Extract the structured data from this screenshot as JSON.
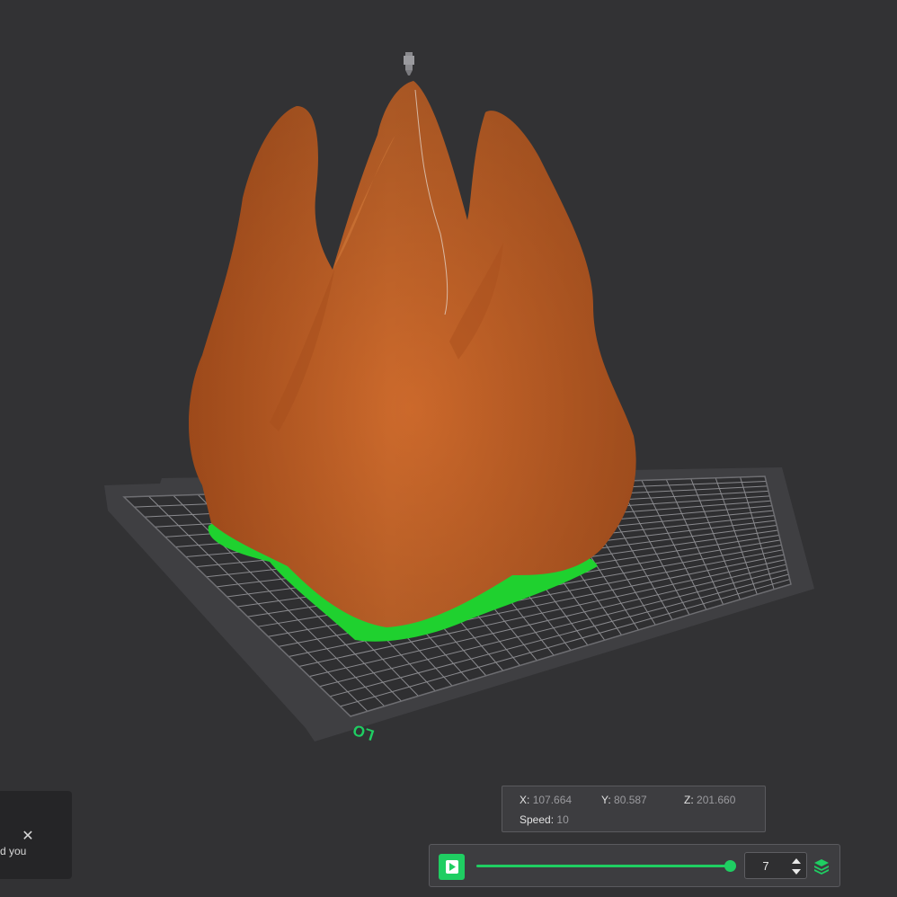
{
  "viewport": {
    "bed_label": "LO",
    "colors": {
      "background": "#323234",
      "bed": "#3f3f42",
      "grid": "#8a8a8e",
      "model": "#c1622b",
      "first_layer": "#1fd12f",
      "accent": "#1fce62"
    }
  },
  "toast": {
    "message": "d you",
    "close_icon": "close-icon"
  },
  "coords": {
    "x_label": "X:",
    "x_value": "107.664",
    "y_label": "Y:",
    "y_value": "80.587",
    "z_label": "Z:",
    "z_value": "201.660",
    "speed_label": "Speed:",
    "speed_value": "10"
  },
  "playback": {
    "play_icon": "play-icon",
    "progress": 1.0,
    "layer_value": "7",
    "layers_icon": "layers-icon"
  }
}
